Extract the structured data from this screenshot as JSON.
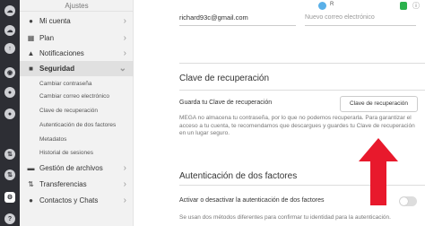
{
  "header": {
    "sidebar_title": "Ajustes",
    "badge": "R",
    "shield_status_color": "#2bb24c",
    "accent_red": "#e8192c"
  },
  "rail_icons": [
    "cloud-icon",
    "upload-icon",
    "camera-icon",
    "cloud-icon",
    "users-icon",
    "chat-icon",
    "transfer-icon",
    "settings-icon"
  ],
  "sidebar": {
    "items": [
      {
        "label": "Mi cuenta",
        "icon": "user-icon"
      },
      {
        "label": "Plan",
        "icon": "grid-icon"
      },
      {
        "label": "Notificaciones",
        "icon": "bell-icon"
      },
      {
        "label": "Seguridad",
        "icon": "lock-icon"
      }
    ],
    "security_subitems": [
      "Cambiar contraseña",
      "Cambiar correo electrónico",
      "Clave de recuperación",
      "Autenticación de dos factores",
      "Metadatos",
      "Historial de sesiones"
    ],
    "more_items": [
      {
        "label": "Gestión de archivos",
        "icon": "folder-icon"
      },
      {
        "label": "Transferencias",
        "icon": "transfer-icon"
      },
      {
        "label": "Contactos y Chats",
        "icon": "chat-icon"
      }
    ]
  },
  "email": {
    "current": "richard93c@gmail.com",
    "new_placeholder": "Nuevo correo electrónico"
  },
  "recovery": {
    "title": "Clave de recuperación",
    "label": "Guarda tu Clave de recuperación",
    "button": "Clave de recuperación",
    "description": "MEGA no almacena tu contraseña, por lo que no podemos recuperarla. Para garantizar el acceso a tu cuenta, te recomendamos que descargues y guardes tu Clave de recuperación en un lugar seguro."
  },
  "twofa": {
    "title": "Autenticación de dos factores",
    "label": "Activar o desactivar la autenticación de dos factores",
    "description": "Se usan dos métodos diferentes para confirmar tu identidad para la autenticación.",
    "toggle_on": false
  }
}
